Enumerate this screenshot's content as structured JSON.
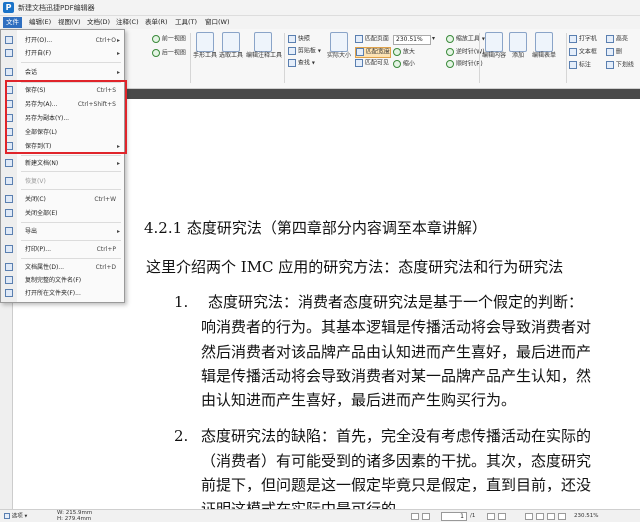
{
  "window": {
    "title": "新建文档迅捷PDF编辑器",
    "logo_letter": "P"
  },
  "menubar": [
    "文件",
    "编辑(E)",
    "视图(V)",
    "文档(D)",
    "注释(C)",
    "表单(R)",
    "工具(T)",
    "窗口(W)"
  ],
  "ribbon": {
    "nav_back": "前一视图",
    "nav_forward": "后一视图",
    "hand_tool": "手形工具",
    "select_tool": "选取工具",
    "edit_annot_tool": "编辑注释工具",
    "snapshot": "快照",
    "clipboard": "剪贴板",
    "find": "查找",
    "actual_size": "实际大小",
    "fit_page": "匹配页面",
    "fit_width": "匹配宽度",
    "fit_visible": "匹配可见",
    "zoom_value": "230.51%",
    "zoom_in": "放大",
    "zoom_out": "缩小",
    "zoom_tool": "缩放工具",
    "rotate_ccw": "逆时针(W)",
    "rotate_cw": "顺时针(R)",
    "edit_content": "编辑内容",
    "add": "添加",
    "edit_form": "编辑表单",
    "typewriter": "打字机",
    "textbox": "文本框",
    "callout": "标注",
    "highlight": "高亮",
    "underline": "下划线",
    "strikeout": "删"
  },
  "file_menu": {
    "items": [
      {
        "label": "打开(O)...",
        "shortcut": "Ctrl+O",
        "arrow": "▸"
      },
      {
        "label": "打开自(F)",
        "shortcut": "",
        "arrow": "▸"
      },
      {
        "label": "会话",
        "shortcut": "",
        "arrow": "▸"
      },
      {
        "label": "保存(S)",
        "shortcut": "Ctrl+S",
        "arrow": ""
      },
      {
        "label": "另存为(A)...",
        "shortcut": "Ctrl+Shift+S",
        "arrow": ""
      },
      {
        "label": "另存为副本(Y)...",
        "shortcut": "",
        "arrow": ""
      },
      {
        "label": "全部保存(L)",
        "shortcut": "",
        "arrow": ""
      },
      {
        "label": "保存到(T)",
        "shortcut": "",
        "arrow": "▸"
      },
      {
        "label": "新建文档(N)",
        "shortcut": "",
        "arrow": "▸"
      },
      {
        "label": "恢复(V)",
        "shortcut": "",
        "arrow": ""
      },
      {
        "label": "关闭(C)",
        "shortcut": "Ctrl+W",
        "arrow": ""
      },
      {
        "label": "关闭全部(E)",
        "shortcut": "",
        "arrow": ""
      },
      {
        "label": "导出",
        "shortcut": "",
        "arrow": "▸"
      },
      {
        "label": "打印(P)...",
        "shortcut": "Ctrl+P",
        "arrow": ""
      },
      {
        "label": "文档属性(D)...",
        "shortcut": "Ctrl+D",
        "arrow": ""
      },
      {
        "label": "复制完整的文件名(F)",
        "shortcut": "",
        "arrow": ""
      },
      {
        "label": "打开所在文件夹(F)...",
        "shortcut": "",
        "arrow": ""
      }
    ]
  },
  "document": {
    "heading": "4.2.1 态度研究法（第四章部分内容调至本章讲解）",
    "intro": "这里介绍两个 IMC 应用的研究方法：态度研究法和行为研究法",
    "item1_num": "1.",
    "item1_lines": [
      "态度研究法：消费者态度研究法是基于一个假定的判断：",
      "响消费者的行为。其基本逻辑是传播活动将会导致消费者对",
      "然后消费者对该品牌产品由认知进而产生喜好，最后进而产",
      "辑是传播活动将会导致消费者对某一品牌产品产生认知，然",
      "由认知进而产生喜好，最后进而产生购买行为。"
    ],
    "item2_num": "2.",
    "item2_lines": [
      "态度研究法的缺陷：首先，完全没有考虑传播活动在实际的",
      "（消费者）有可能受到的诸多因素的干扰。其次，态度研究",
      "前提下，但问题是这一假定毕竟只是假定，直到目前，还没",
      "证明这模式在实际中是可行的"
    ]
  },
  "statusbar": {
    "mode": "选项",
    "width": "W: 215.9mm",
    "height": "H: 279.4mm",
    "page_current": "1",
    "page_total": "/1",
    "zoom": "230.51%"
  }
}
